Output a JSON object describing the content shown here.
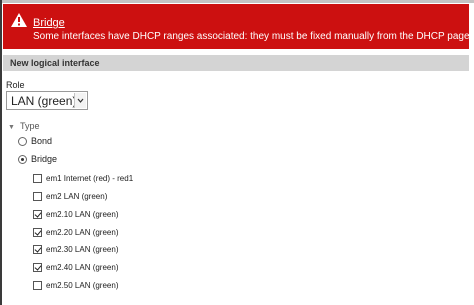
{
  "error": {
    "title": "Bridge",
    "message": "Some interfaces have DHCP ranges associated: they must be fixed manually from the DHCP page"
  },
  "section": {
    "title": "New logical interface"
  },
  "role": {
    "label": "Role",
    "selected": "LAN (green)"
  },
  "type": {
    "label": "Type",
    "options": [
      {
        "label": "Bond",
        "checked": false
      },
      {
        "label": "Bridge",
        "checked": true
      }
    ]
  },
  "interfaces": [
    {
      "label": "em1 Internet (red) - red1",
      "checked": false
    },
    {
      "label": "em2 LAN (green)",
      "checked": false
    },
    {
      "label": "em2.10 LAN (green)",
      "checked": true
    },
    {
      "label": "em2.20 LAN (green)",
      "checked": true
    },
    {
      "label": "em2.30 LAN (green)",
      "checked": true
    },
    {
      "label": "em2.40 LAN (green)",
      "checked": true
    },
    {
      "label": "em2.50 LAN (green)",
      "checked": false
    }
  ],
  "colors": {
    "error_bg": "#cc1010",
    "header_bg": "#d4d4d4"
  }
}
